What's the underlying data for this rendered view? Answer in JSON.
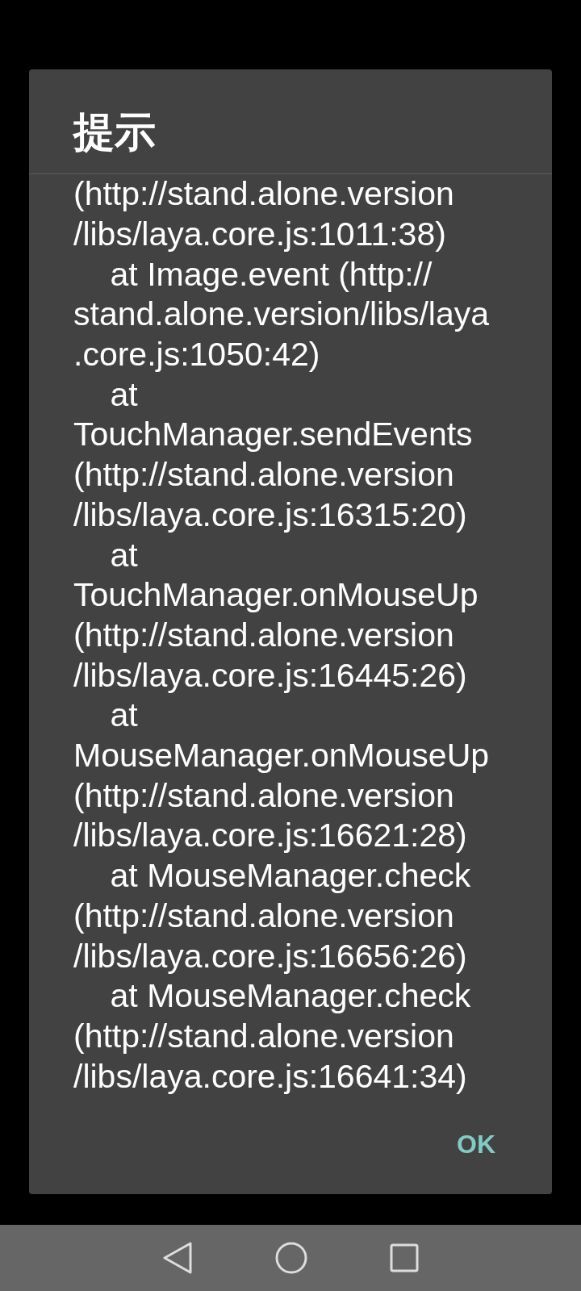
{
  "dialog": {
    "title": "提示",
    "message_lines": [
      "(http://stand.alone.version",
      "/libs/laya.core.js:1011:38)",
      "    at Image.event (http://",
      "stand.alone.version/libs/laya",
      ".core.js:1050:42)",
      "    at",
      "TouchManager.sendEvents",
      "(http://stand.alone.version",
      "/libs/laya.core.js:16315:20)",
      "    at",
      "TouchManager.onMouseUp",
      "(http://stand.alone.version",
      "/libs/laya.core.js:16445:26)",
      "    at",
      "MouseManager.onMouseUp",
      "(http://stand.alone.version",
      "/libs/laya.core.js:16621:28)",
      "    at MouseManager.check",
      "(http://stand.alone.version",
      "/libs/laya.core.js:16656:26)",
      "    at MouseManager.check",
      "(http://stand.alone.version",
      "/libs/laya.core.js:16641:34)"
    ],
    "buttons": [
      "OK"
    ]
  }
}
